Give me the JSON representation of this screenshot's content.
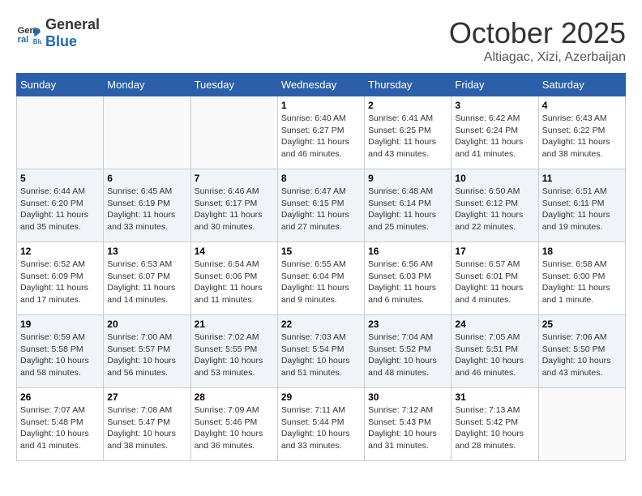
{
  "header": {
    "logo_general": "General",
    "logo_blue": "Blue",
    "month_title": "October 2025",
    "location": "Altiagac, Xizi, Azerbaijan"
  },
  "weekdays": [
    "Sunday",
    "Monday",
    "Tuesday",
    "Wednesday",
    "Thursday",
    "Friday",
    "Saturday"
  ],
  "weeks": [
    [
      {
        "day": "",
        "sunrise": "",
        "sunset": "",
        "daylight": ""
      },
      {
        "day": "",
        "sunrise": "",
        "sunset": "",
        "daylight": ""
      },
      {
        "day": "",
        "sunrise": "",
        "sunset": "",
        "daylight": ""
      },
      {
        "day": "1",
        "sunrise": "Sunrise: 6:40 AM",
        "sunset": "Sunset: 6:27 PM",
        "daylight": "Daylight: 11 hours and 46 minutes."
      },
      {
        "day": "2",
        "sunrise": "Sunrise: 6:41 AM",
        "sunset": "Sunset: 6:25 PM",
        "daylight": "Daylight: 11 hours and 43 minutes."
      },
      {
        "day": "3",
        "sunrise": "Sunrise: 6:42 AM",
        "sunset": "Sunset: 6:24 PM",
        "daylight": "Daylight: 11 hours and 41 minutes."
      },
      {
        "day": "4",
        "sunrise": "Sunrise: 6:43 AM",
        "sunset": "Sunset: 6:22 PM",
        "daylight": "Daylight: 11 hours and 38 minutes."
      }
    ],
    [
      {
        "day": "5",
        "sunrise": "Sunrise: 6:44 AM",
        "sunset": "Sunset: 6:20 PM",
        "daylight": "Daylight: 11 hours and 35 minutes."
      },
      {
        "day": "6",
        "sunrise": "Sunrise: 6:45 AM",
        "sunset": "Sunset: 6:19 PM",
        "daylight": "Daylight: 11 hours and 33 minutes."
      },
      {
        "day": "7",
        "sunrise": "Sunrise: 6:46 AM",
        "sunset": "Sunset: 6:17 PM",
        "daylight": "Daylight: 11 hours and 30 minutes."
      },
      {
        "day": "8",
        "sunrise": "Sunrise: 6:47 AM",
        "sunset": "Sunset: 6:15 PM",
        "daylight": "Daylight: 11 hours and 27 minutes."
      },
      {
        "day": "9",
        "sunrise": "Sunrise: 6:48 AM",
        "sunset": "Sunset: 6:14 PM",
        "daylight": "Daylight: 11 hours and 25 minutes."
      },
      {
        "day": "10",
        "sunrise": "Sunrise: 6:50 AM",
        "sunset": "Sunset: 6:12 PM",
        "daylight": "Daylight: 11 hours and 22 minutes."
      },
      {
        "day": "11",
        "sunrise": "Sunrise: 6:51 AM",
        "sunset": "Sunset: 6:11 PM",
        "daylight": "Daylight: 11 hours and 19 minutes."
      }
    ],
    [
      {
        "day": "12",
        "sunrise": "Sunrise: 6:52 AM",
        "sunset": "Sunset: 6:09 PM",
        "daylight": "Daylight: 11 hours and 17 minutes."
      },
      {
        "day": "13",
        "sunrise": "Sunrise: 6:53 AM",
        "sunset": "Sunset: 6:07 PM",
        "daylight": "Daylight: 11 hours and 14 minutes."
      },
      {
        "day": "14",
        "sunrise": "Sunrise: 6:54 AM",
        "sunset": "Sunset: 6:06 PM",
        "daylight": "Daylight: 11 hours and 11 minutes."
      },
      {
        "day": "15",
        "sunrise": "Sunrise: 6:55 AM",
        "sunset": "Sunset: 6:04 PM",
        "daylight": "Daylight: 11 hours and 9 minutes."
      },
      {
        "day": "16",
        "sunrise": "Sunrise: 6:56 AM",
        "sunset": "Sunset: 6:03 PM",
        "daylight": "Daylight: 11 hours and 6 minutes."
      },
      {
        "day": "17",
        "sunrise": "Sunrise: 6:57 AM",
        "sunset": "Sunset: 6:01 PM",
        "daylight": "Daylight: 11 hours and 4 minutes."
      },
      {
        "day": "18",
        "sunrise": "Sunrise: 6:58 AM",
        "sunset": "Sunset: 6:00 PM",
        "daylight": "Daylight: 11 hours and 1 minute."
      }
    ],
    [
      {
        "day": "19",
        "sunrise": "Sunrise: 6:59 AM",
        "sunset": "Sunset: 5:58 PM",
        "daylight": "Daylight: 10 hours and 58 minutes."
      },
      {
        "day": "20",
        "sunrise": "Sunrise: 7:00 AM",
        "sunset": "Sunset: 5:57 PM",
        "daylight": "Daylight: 10 hours and 56 minutes."
      },
      {
        "day": "21",
        "sunrise": "Sunrise: 7:02 AM",
        "sunset": "Sunset: 5:55 PM",
        "daylight": "Daylight: 10 hours and 53 minutes."
      },
      {
        "day": "22",
        "sunrise": "Sunrise: 7:03 AM",
        "sunset": "Sunset: 5:54 PM",
        "daylight": "Daylight: 10 hours and 51 minutes."
      },
      {
        "day": "23",
        "sunrise": "Sunrise: 7:04 AM",
        "sunset": "Sunset: 5:52 PM",
        "daylight": "Daylight: 10 hours and 48 minutes."
      },
      {
        "day": "24",
        "sunrise": "Sunrise: 7:05 AM",
        "sunset": "Sunset: 5:51 PM",
        "daylight": "Daylight: 10 hours and 46 minutes."
      },
      {
        "day": "25",
        "sunrise": "Sunrise: 7:06 AM",
        "sunset": "Sunset: 5:50 PM",
        "daylight": "Daylight: 10 hours and 43 minutes."
      }
    ],
    [
      {
        "day": "26",
        "sunrise": "Sunrise: 7:07 AM",
        "sunset": "Sunset: 5:48 PM",
        "daylight": "Daylight: 10 hours and 41 minutes."
      },
      {
        "day": "27",
        "sunrise": "Sunrise: 7:08 AM",
        "sunset": "Sunset: 5:47 PM",
        "daylight": "Daylight: 10 hours and 38 minutes."
      },
      {
        "day": "28",
        "sunrise": "Sunrise: 7:09 AM",
        "sunset": "Sunset: 5:46 PM",
        "daylight": "Daylight: 10 hours and 36 minutes."
      },
      {
        "day": "29",
        "sunrise": "Sunrise: 7:11 AM",
        "sunset": "Sunset: 5:44 PM",
        "daylight": "Daylight: 10 hours and 33 minutes."
      },
      {
        "day": "30",
        "sunrise": "Sunrise: 7:12 AM",
        "sunset": "Sunset: 5:43 PM",
        "daylight": "Daylight: 10 hours and 31 minutes."
      },
      {
        "day": "31",
        "sunrise": "Sunrise: 7:13 AM",
        "sunset": "Sunset: 5:42 PM",
        "daylight": "Daylight: 10 hours and 28 minutes."
      },
      {
        "day": "",
        "sunrise": "",
        "sunset": "",
        "daylight": ""
      }
    ]
  ]
}
